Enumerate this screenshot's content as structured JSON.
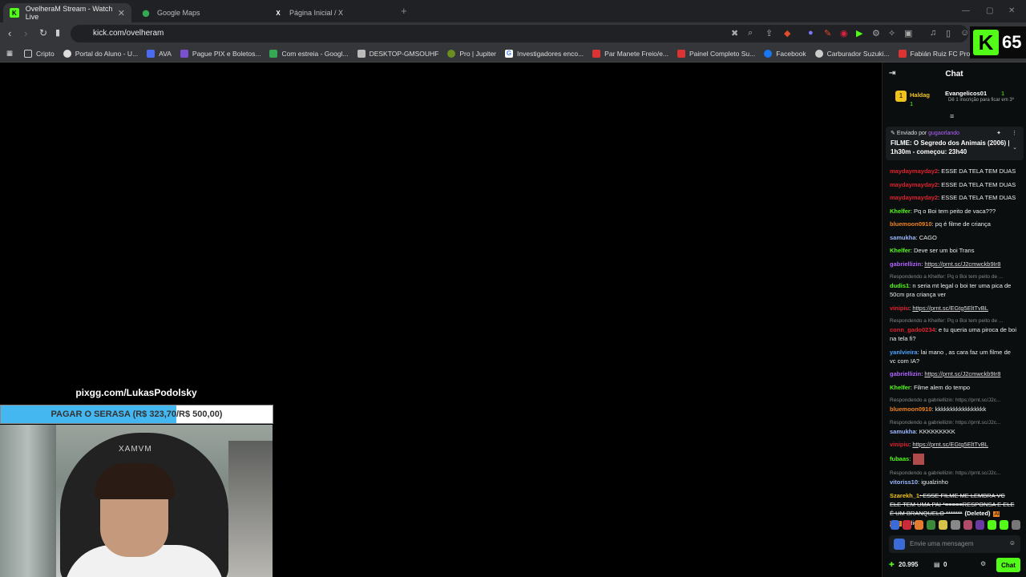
{
  "tabs": [
    {
      "title": "OvelheraM Stream - Watch Live",
      "icon": "kick-icon"
    },
    {
      "title": "Google Maps",
      "icon": "maps-icon"
    },
    {
      "title": "Página Inicial / X",
      "icon": "x-icon"
    }
  ],
  "address": {
    "url": "kick.com/ovelheram"
  },
  "bookmarks": [
    "Cripto",
    "Portal do Aluno - U...",
    "AVA",
    "Pague PIX e Boletos...",
    "Com estreia - Googl...",
    "DESKTOP-GMSOUHF",
    "Pro | Jupiter",
    "Investigadores enco...",
    "Par Manete Freio/e...",
    "Painel Completo Su...",
    "Facebook",
    "Carburador Suzuki...",
    "Fabián Ruiz FC Pro L..."
  ],
  "kick_badge": {
    "count": "65"
  },
  "overlay": {
    "pix": "pixgg.com/LukasPodolsky",
    "goal_text": "PAGAR O SERASA (R$ 323,70/R$ 500,00)",
    "goal_progress": 0.647
  },
  "webcam": {
    "chair_text": "XAMVM"
  },
  "chat": {
    "title": "Chat",
    "gifters": {
      "user1": "Haldag",
      "user1_count": "1",
      "user2": "Evangelicos01",
      "user2_count": "1",
      "note": "Dê 1 inscrição para ficar em 3º"
    },
    "pinned": {
      "sent_by_label": "Enviado por",
      "sender": "gugaorlando",
      "message": "FILME: O Segredo dos Animais (2006) | 1h30m - começou: 23h40"
    },
    "messages": [
      {
        "user": "maydaymayday2",
        "color": "#e0222e",
        "text": ": ESSE DA TELA TEM DUAS"
      },
      {
        "user": "maydaymayday2",
        "color": "#e0222e",
        "text": ": ESSE DA TELA TEM DUAS"
      },
      {
        "user": "maydaymayday2",
        "color": "#e0222e",
        "text": ": ESSE DA TELA TEM DUAS"
      },
      {
        "user": "Khelfer",
        "color": "#53fc18",
        "text": ": Pq o Boi tem peito de vaca???"
      },
      {
        "user": "bluemoon0910",
        "color": "#f0831c",
        "text": ": pq é filme de criança"
      },
      {
        "user": "samukha",
        "color": "#9ab8ff",
        "text": ": CAGO"
      },
      {
        "user": "Khelfer",
        "color": "#53fc18",
        "text": ": Deve ser um boi Trans"
      },
      {
        "user": "gabriellizin",
        "color": "#b062ff",
        "text": ": ",
        "link": "https://prnt.sc/J2cmwckb9Ir8"
      },
      {
        "reply": "Respondendo a Khelfer: Pq o Boi tem peito de ...",
        "user": "dudis1",
        "color": "#53fc18",
        "text": ": n seria mt legal o boi ter uma pica de 50cm pra criança ver"
      },
      {
        "user": "vinipiu",
        "color": "#e0222e",
        "text": ": ",
        "link": "https://prnt.sc/EGtg5EltTvBL"
      },
      {
        "reply": "Respondendo a Khelfer: Pq o Boi tem peito de ...",
        "user": "conn_gado0234",
        "color": "#e0222e",
        "text": ": e tu queria uma piroca de boi na tela fi?"
      },
      {
        "user": "yanlvieira",
        "color": "#4ca3ff",
        "text": ": lai mano , as cara faz um filme de vc com IA?"
      },
      {
        "user": "gabriellizin",
        "color": "#b062ff",
        "text": ": ",
        "link": "https://prnt.sc/J2cmwckb9Ir8"
      },
      {
        "user": "Khelfer",
        "color": "#53fc18",
        "text": ": Filme alem do tempo"
      },
      {
        "reply": "Respondendo a gabriellizin: https://prnt.sc/J2c...",
        "user": "bluemoon0910",
        "color": "#f0831c",
        "text": ": kkkkkkkkkkkkkkkkk"
      },
      {
        "reply": "Respondendo a gabriellizin: https://prnt.sc/J2c...",
        "user": "samukha",
        "color": "#9ab8ff",
        "text": ": KKKKKKKKK"
      },
      {
        "user": "vinipiu",
        "color": "#e0222e",
        "text": ": ",
        "link": "https://prnt.sc/EGtg5EltTvBL"
      },
      {
        "user": "fubaas",
        "color": "#53fc18",
        "text": ":"
      },
      {
        "reply": "Respondendo a gabriellizin: https://prnt.sc/J2c...",
        "user": "vitoriss10",
        "color": "#9ab8ff",
        "text": ": igualzinho"
      },
      {
        "user": "Szarekh_1",
        "color": "#f0c31c",
        "text": ": ESSE FILME ME LEMBRA VC ELE TEM UMA PAI *=====RESPONSA E ELE É UM BRANQUELO *******",
        "deleted": "(Deleted)",
        "tag": "AI Mod",
        "tag2": "(ódio)"
      }
    ],
    "input_placeholder": "Envie uma mensagem",
    "viewers": "20.995",
    "count2": "0",
    "chat_button": "Chat"
  }
}
